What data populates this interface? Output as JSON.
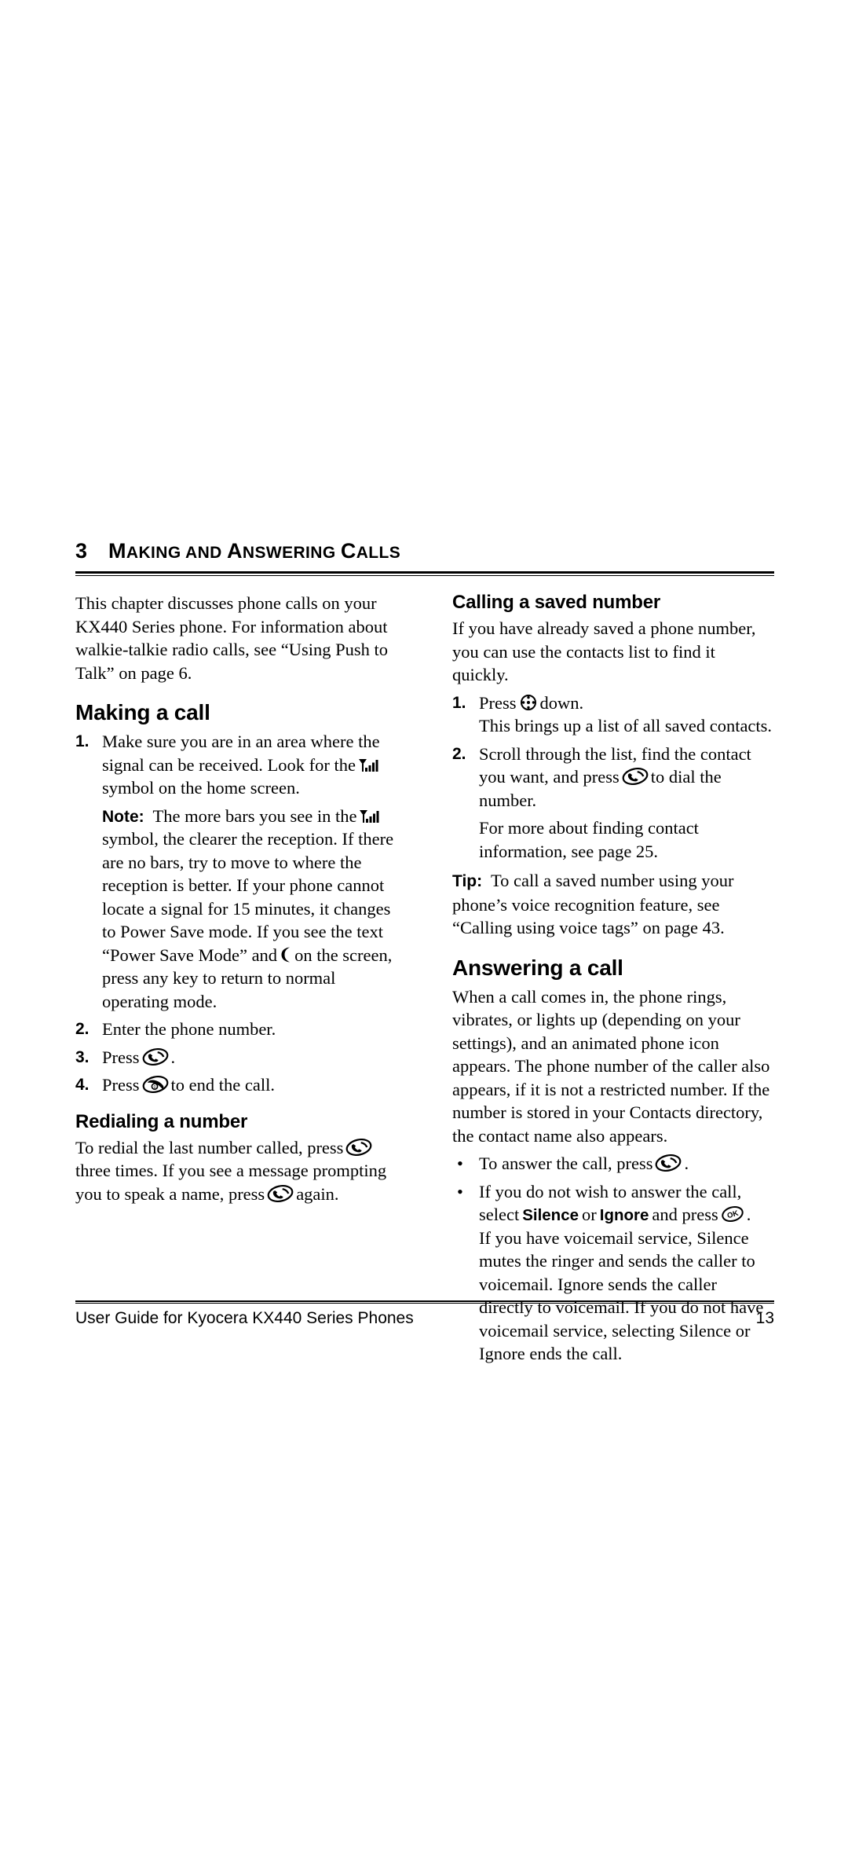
{
  "document": {
    "chapter_number": "3",
    "chapter_title_first": "M",
    "chapter_title_rest": "AKING AND ",
    "chapter_title": "MAKING AND ANSWERING CALLS",
    "chapter_title_parts": {
      "m": "M",
      "aking_and": "AKING AND ",
      "a": "A",
      "nswering": "NSWERING ",
      "c": "C",
      "alls": "ALLS"
    }
  },
  "left_column": {
    "intro": "This chapter discusses phone calls on your KX440 Series phone. For information about walkie-talkie radio calls, see “Using Push to Talk” on page 6.",
    "making_a_call": {
      "heading": "Making a call",
      "step1_num": "1.",
      "step1_part1": "Make sure you are in an area where the signal can be received. Look for the",
      "step1_icon": "signal-strength-icon",
      "step1_part2": "symbol on the home screen.",
      "note_label": "Note:",
      "note_part1": "The more bars you see in the",
      "note_icon1": "signal-strength-icon",
      "note_part2": "symbol, the clearer the reception. If there are no bars, try to move to where the reception is better. If your phone cannot locate a signal for 15 minutes, it changes to Power Save mode. If you see the text “Power Save Mode” and",
      "note_icon2": "power-save-icon",
      "note_part3": "on the screen, press any key to return to normal operating mode.",
      "step2_num": "2.",
      "step2_text": "Enter the phone number.",
      "step3_num": "3.",
      "step3_part1": "Press",
      "step3_icon": "send-key-icon",
      "step3_part2": ".",
      "step4_num": "4.",
      "step4_part1": "Press",
      "step4_icon": "end-key-icon",
      "step4_part2": "to end the call."
    },
    "redialing": {
      "heading": "Redialing a number",
      "part1": "To redial the last number called, press",
      "icon1": "send-key-icon",
      "part2": "three times. If you see a message prompting you to speak a name, press",
      "icon2": "send-key-icon",
      "part3": "again."
    }
  },
  "right_column": {
    "calling_saved": {
      "heading": "Calling a saved number",
      "intro": "If you have already saved a phone number, you can use the contacts list to find it quickly.",
      "step1_num": "1.",
      "step1_part1": "Press",
      "step1_icon": "navigation-key-icon",
      "step1_part2": "down.",
      "step1_sub": "This brings up a list of all saved contacts.",
      "step2_num": "2.",
      "step2_part1": "Scroll through the list, find the contact you want, and press",
      "step2_icon": "send-key-icon",
      "step2_part2": "to dial the number.",
      "step2_sub": "For more about finding contact information, see page 25.",
      "tip_label": "Tip:",
      "tip_text": "To call a saved number using your phone’s voice recognition feature, see “Calling using voice tags” on page 43."
    },
    "answering": {
      "heading": "Answering a call",
      "intro": "When a call comes in, the phone rings, vibrates, or lights up (depending on your settings), and an animated phone icon appears. The phone number of the caller also appears, if it is not a restricted number. If the number is stored in your Contacts directory, the contact name also appears.",
      "bullet1_dot": "•",
      "bullet1_part1": "To answer the call, press",
      "bullet1_icon": "send-key-icon",
      "bullet1_part2": ".",
      "bullet2_dot": "•",
      "bullet2_part1": "If you do not wish to answer the call, select",
      "bullet2_silence": "Silence",
      "bullet2_or": "or",
      "bullet2_ignore": "Ignore",
      "bullet2_part2": "and press",
      "bullet2_icon": "ok-key-icon",
      "bullet2_part3": ".",
      "bullet2_sub": "If you have voicemail service, Silence mutes the ringer and sends the caller to voicemail. Ignore sends the caller directly to voicemail. If you do not have voicemail service, selecting Silence or Ignore ends the call."
    }
  },
  "footer": {
    "text": "User Guide for Kyocera KX440 Series Phones",
    "page_number": "13"
  }
}
